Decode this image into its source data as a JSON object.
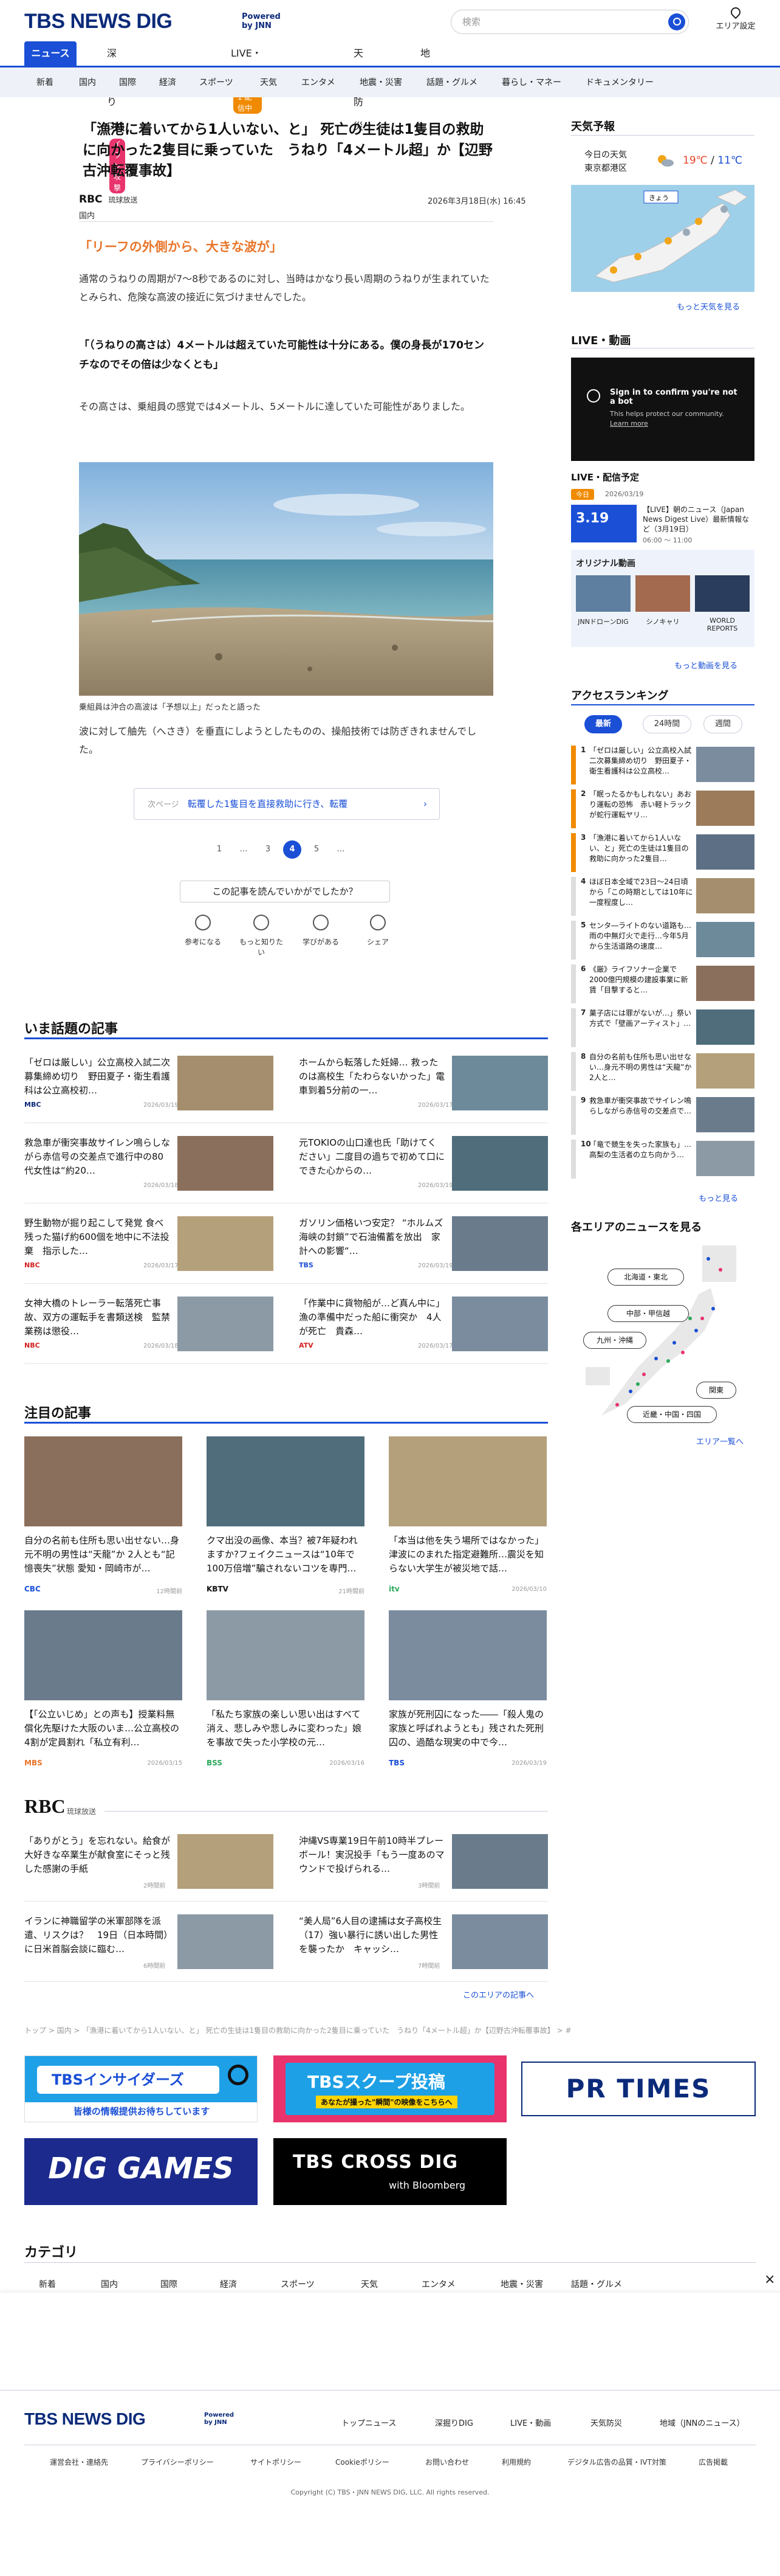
{
  "header": {
    "logo": "TBS NEWS DIG",
    "powered_line1": "Powered",
    "powered_line2": "by JNN",
    "search_placeholder": "検索",
    "area_setting": "エリア設定"
  },
  "nav_primary": [
    {
      "label": "ニュース"
    },
    {
      "label": "深掘りDIG",
      "badge": "イラン攻撃"
    },
    {
      "label": "LIVE・動画",
      "badge": "1 配信中"
    },
    {
      "label": "天気防災"
    },
    {
      "label": "地域"
    }
  ],
  "nav_secondary": [
    "新着",
    "国内",
    "国際",
    "経済",
    "スポーツ",
    "天気",
    "エンタメ",
    "地震・災害",
    "話題・グルメ",
    "暮らし・マネー",
    "ドキュメンタリー"
  ],
  "article": {
    "title": "「漁港に着いてから1人いない、と」 死亡の生徒は1隻目の救助に向かった2隻目に乗っていた　うねり「4メートル超」か【辺野古沖転覆事故】",
    "source": "RBC",
    "source_name": "琉球放送",
    "datetime": "2026年3月18日(水) 16:45",
    "category": "国内",
    "subheading": "「リーフの外側から、大きな波が」",
    "para1": "通常のうねりの周期が7～8秒であるのに対し、当時はかなり長い周期のうねりが生まれていたとみられ、危険な高波の接近に気づけませんでした。",
    "quote": "「（うねりの高さは）4メートルは超えていた可能性は十分にある。僕の身長が170センチなのでその倍は少なくとも」",
    "para2": "その高さは、乗組員の感覚では4メートル、5メートルに達していた可能性がありました。",
    "photo_caption": "乗組員は沖合の高波は「予想以上」だったと語った",
    "para3": "波に対して舳先（へさき）を垂直にしようとしたものの、操船技術では防ぎきれませんでした。",
    "next_label": "次ページ",
    "next_text": "転覆した1隻目を直接救助に行き、転覆",
    "pager": [
      "1",
      "…",
      "3",
      "4",
      "5",
      "…"
    ],
    "survey": "この記事を読んでいかがでしたか？",
    "reactions": [
      "参考になる",
      "もっと知りたい",
      "学びがある",
      "シェア"
    ]
  },
  "sidebar": {
    "weather_title": "天気予報",
    "today_weather_label": "今日の天気",
    "weather_area": "東京都港区",
    "temp_high": "19℃",
    "temp_low": "11℃",
    "weather_more": "もっと天気を見る",
    "live_title": "LIVE・動画",
    "live_signin": "Sign in to confirm you're not a bot",
    "live_signin_sub": "This helps protect our community.",
    "live_learn": "Learn more",
    "schedule_title": "LIVE・配信予定",
    "schedule_badge": "今日",
    "schedule_date": "2026/03/19",
    "schedule_date_big": "3.19",
    "schedule_title_text": "【LIVE】朝のニュース（Japan News Digest Live）最新情報など（3月19日）",
    "schedule_time": "06:00 ～ 11:00",
    "original_title": "オリジナル動画",
    "original_items": [
      "JNNドローンDIG",
      "シノキャリ",
      "WORLD REPORTS"
    ],
    "original_more": "もっと動画を見る",
    "ranking_title": "アクセスランキング",
    "ranking_tabs": [
      "最新",
      "24時間",
      "週間"
    ],
    "ranking": [
      "「ゼロは厳しい」公立高校入試二次募集締め切り　野田夏子・衛生看護科は公立高校…",
      "「眠ったるかもしれない」あおり運転の恐怖　赤い軽トラックが蛇行運転ヤリ…",
      "「漁港に着いてから1人いない、と」死亡の生徒は1隻目の救助に向かった2隻目…",
      "ほぼ日本全域で23日～24日頃から「この時期としては10年に一度程度し…",
      "センタ―ライトのない道路も…雨の中無灯火で走行…今年5月から生活道路の速度…",
      "《厳》ライフソナー企業で2000億円規模の建設事業に新賃「目撃すると…",
      "菓子店には罪がないが…」祭い方式で「壁画アーティスト」…",
      "自分の名前も住所も思い出せない…身元不明の男性は“天龍”か2人と…",
      "救急車が衝突事故でサイレン鳴らしながら赤信号の交差点で…",
      "「竜で競生を失った家族も」…高梨の生活者の立ち向かう…"
    ],
    "ranking_more": "もっと見る",
    "area_title": "各エリアのニュースを見る",
    "areas": [
      "北海道・東北",
      "中部・甲信越",
      "九州・沖縄",
      "関東",
      "近畿・中国・四国"
    ],
    "area_more": "エリア一覧へ"
  },
  "topics": {
    "title": "いま話題の記事",
    "items": [
      {
        "t": "「ゼロは厳しい」公立高校入試二次募集締め切り　野田夏子・衛生看護科は公立高校初…",
        "src": "MBC",
        "date": "2026/03/19"
      },
      {
        "t": "ホームから転落した妊婦… 救ったのは高校生「たわらないかった」電車到着5分前の一…",
        "src": "",
        "date": "2026/03/17"
      },
      {
        "t": "救急車が衝突事故サイレン鳴らしながら赤信号の交差点で進行中の80代女性は“約20…",
        "src": "",
        "date": "2026/03/18"
      },
      {
        "t": "元TOKIOの山口達也氏「助けてください」二度目の過ちで初めて口にできた心からの…",
        "src": "",
        "date": "2026/03/19"
      },
      {
        "t": "野生動物が掘り起こして発覚 食べ残った猫げ約600個を地中に不法投棄　指示した…",
        "src": "NBC",
        "date": "2026/03/17"
      },
      {
        "t": "ガソリン価格いつ安定？ “ホルムズ海峡の封鎖”で石油備蓄を放出　家計への影響“…",
        "src": "TBS",
        "date": "2026/03/19"
      },
      {
        "t": "女神大橋のトレーラー転落死亡事故、双方の運転手を書類送検　監禁業務は懲役…",
        "src": "NBC",
        "date": "2026/03/18"
      },
      {
        "t": "「作業中に貨物船が…ど真ん中に」漁の準備中だった船に衝突か　4人が死亡　貴森…",
        "src": "ATV",
        "date": "2026/03/17"
      }
    ]
  },
  "featured": {
    "title": "注目の記事",
    "items": [
      {
        "t": "自分の名前も住所も思い出せない…身元不明の男性は“天龍”か 2人とも“記憶喪失”状態 愛知・岡崎市が…",
        "src": "CBC",
        "date": "12時間前"
      },
      {
        "t": "クマ出没の画像、本当？被7年疑われますか?フェイクニュースは“10年で100万倍増”騙されないコツを専門…",
        "src": "KBTV",
        "date": "21時間前"
      },
      {
        "t": "「本当は他を失う場所ではなかった」津波にのまれた指定避難所…震災を知らない大学生が被災地で話…",
        "src": "itv",
        "date": "2026/03/10"
      },
      {
        "t": "【「公立いじめ」との声も】授業料無償化先駆けた大阪のいま…公立高校の4割が定員割れ「私立有利…",
        "src": "MBS",
        "date": "2026/03/15"
      },
      {
        "t": "「私たち家族の楽しい思い出はすべて消え、悲しみや悲しみに変わった」娘を事故で失った小学校の元…",
        "src": "BSS",
        "date": "2026/03/16"
      },
      {
        "t": "家族が死刑囚になった――「殺人鬼の家族と呼ばれようとも」残された死刑囚の、過酷な現実の中で今…",
        "src": "TBS",
        "date": "2026/03/19"
      }
    ]
  },
  "rbc": {
    "logo": "RBC",
    "name": "琉球放送",
    "items": [
      {
        "t": "「ありがとう」を忘れない。給食が大好きな卒業生が献食室にそっと残した感謝の手紙",
        "date": "2時間前"
      },
      {
        "t": "沖縄VS専業19日午前10時半プレーボール！実況投手「もう一度あのマウンドで投げられる…",
        "date": "3時間前"
      },
      {
        "t": "イランに神職留学の米軍部隊を派遣、リスクは？　19日（日本時間）に日米首脳会談に臨む…",
        "date": "6時間前"
      },
      {
        "t": "“美人局”6人目の逮捕は女子高校生（17）強い暴行に誘い出した男性を襲ったか　キャッシ…",
        "date": "7時間前"
      }
    ],
    "more": "このエリアの記事へ"
  },
  "breadcrumb": "トップ > 国内 > 「漁港に着いてから1人いない、と」 死亡の生徒は1隻目の救助に向かった2隻目に乗っていた　うねり「4メートル超」か【辺野古沖転覆事故】 > #ページ目",
  "banners": [
    {
      "label": "TBSインサイダーズ",
      "sub": "皆様の情報提供お待ちしています"
    },
    {
      "label": "TBSスクープ投稿",
      "sub": "あなたが撮った\"瞬間\"の映像をこちらへ"
    },
    {
      "label": "PR TIMES"
    },
    {
      "label": "DIG GAMES"
    },
    {
      "label": "TBS CROSS DIG",
      "sub": "with Bloomberg"
    }
  ],
  "category": {
    "title": "カテゴリ",
    "items": [
      "新着",
      "国内",
      "国際",
      "経済",
      "スポーツ",
      "天気",
      "エンタメ",
      "地震・災害",
      "話題・グルメ"
    ]
  },
  "footer": {
    "logo": "TBS NEWS DIG",
    "powered_line1": "Powered",
    "powered_line2": "by JNN",
    "links": [
      "トップニュース",
      "深掘りDIG",
      "LIVE・動画",
      "天気防災",
      "地域（JNNのニュース）"
    ],
    "sublinks": [
      "運営会社・連絡先",
      "プライバシーポリシー",
      "サイトポリシー",
      "Cookieポリシー",
      "お問い合わせ",
      "利用規約",
      "デジタル広告の品質・IVT対策",
      "広告掲載"
    ],
    "copyright": "Copyright (C) TBS・JNN NEWS DIG, LLC. All rights reserved."
  },
  "colors": {
    "brand": "#1a4fd6",
    "navy": "#0b2a7a",
    "accent_orange": "#e8752a"
  }
}
